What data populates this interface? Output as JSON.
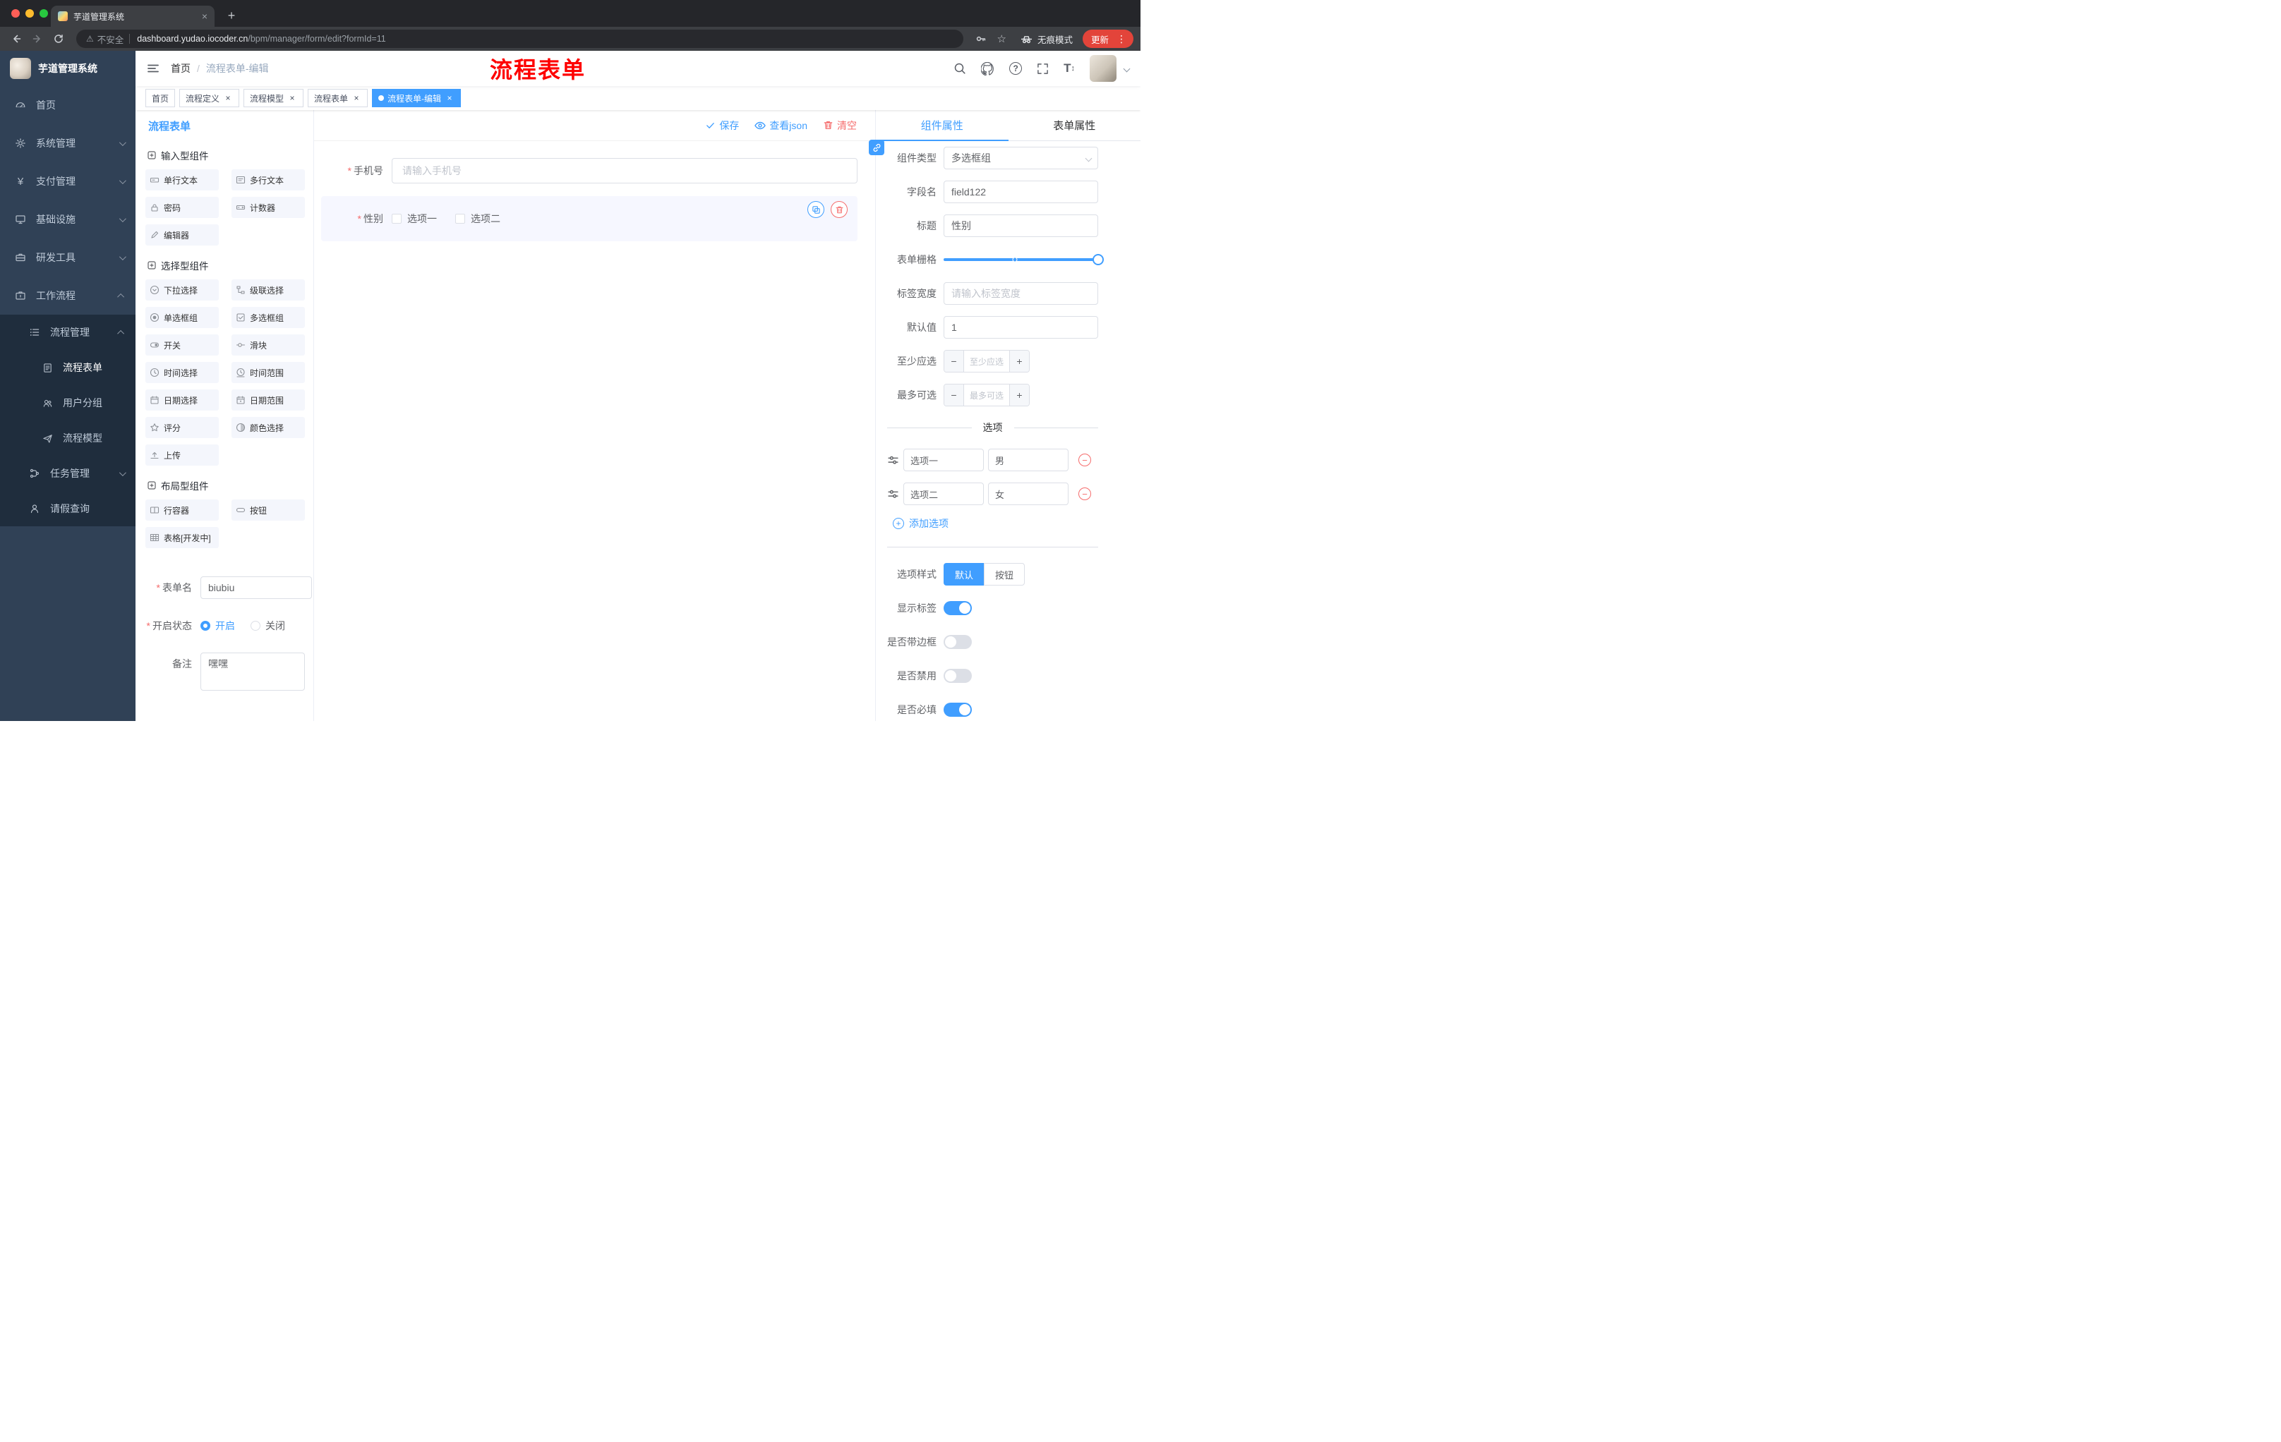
{
  "glyphs": {
    "close": "×",
    "plus": "+",
    "minus": "−",
    "kebab": "⋮",
    "yen": "¥",
    "question": "?",
    "font_t": "T",
    "updown": "↕",
    "warning": "⚠",
    "star": "☆",
    "slash": "/",
    "required": "*"
  },
  "browser": {
    "tab_title": "芋道管理系统",
    "security_label": "不安全",
    "url_host": "dashboard.yudao.iocoder.cn",
    "url_path": "/bpm/manager/form/edit?formId=11",
    "incognito_label": "无痕模式",
    "update_label": "更新"
  },
  "sidebar": {
    "logo_title": "芋道管理系统",
    "menu": [
      {
        "label": "首页",
        "icon": "dashboard-icon"
      },
      {
        "label": "系统管理",
        "icon": "gear-icon"
      },
      {
        "label": "支付管理",
        "icon": "yen-icon"
      },
      {
        "label": "基础设施",
        "icon": "monitor-icon"
      },
      {
        "label": "研发工具",
        "icon": "toolbox-icon"
      },
      {
        "label": "工作流程",
        "icon": "briefcase-icon"
      }
    ],
    "process_group": {
      "label": "流程管理",
      "children": [
        {
          "label": "流程表单",
          "icon": "document-icon"
        },
        {
          "label": "用户分组",
          "icon": "users-icon"
        },
        {
          "label": "流程模型",
          "icon": "send-icon"
        }
      ]
    },
    "task_group": {
      "label": "任务管理"
    },
    "leave_item": {
      "label": "请假查询"
    }
  },
  "header": {
    "breadcrumb_home": "首页",
    "breadcrumb_current": "流程表单-编辑",
    "annotation": "流程表单"
  },
  "tags": [
    {
      "label": "首页"
    },
    {
      "label": "流程定义"
    },
    {
      "label": "流程模型"
    },
    {
      "label": "流程表单"
    },
    {
      "label": "流程表单-编辑"
    }
  ],
  "designer": {
    "title": "流程表单",
    "toolbar": {
      "save": "保存",
      "view_json": "查看json",
      "clear": "清空"
    },
    "palette": [
      {
        "title": "输入型组件",
        "items": [
          "单行文本",
          "多行文本",
          "密码",
          "计数器",
          "编辑器"
        ]
      },
      {
        "title": "选择型组件",
        "items": [
          "下拉选择",
          "级联选择",
          "单选框组",
          "多选框组",
          "开关",
          "滑块",
          "时间选择",
          "时间范围",
          "日期选择",
          "日期范围",
          "评分",
          "颜色选择",
          "上传"
        ]
      },
      {
        "title": "布局型组件",
        "items": [
          "行容器",
          "按钮",
          "表格[开发中]"
        ]
      }
    ],
    "meta": {
      "name_label": "表单名",
      "name_value": "biubiu",
      "status_label": "开启状态",
      "status_on": "开启",
      "status_off": "关闭",
      "remark_label": "备注",
      "remark_value": "嘿嘿"
    }
  },
  "canvas": {
    "phone_label": "手机号",
    "phone_placeholder": "请输入手机号",
    "gender_label": "性别",
    "option1": "选项一",
    "option2": "选项二"
  },
  "props": {
    "tab_component": "组件属性",
    "tab_form": "表单属性",
    "type_label": "组件类型",
    "type_value": "多选框组",
    "field_label": "字段名",
    "field_value": "field122",
    "title_label": "标题",
    "title_value": "性别",
    "grid_label": "表单栅格",
    "labelwidth_label": "标签宽度",
    "labelwidth_placeholder": "请输入标签宽度",
    "default_label": "默认值",
    "default_value": "1",
    "min_label": "至少应选",
    "min_placeholder": "至少应选",
    "max_label": "最多可选",
    "max_placeholder": "最多可选",
    "options_divider": "选项",
    "options": [
      {
        "label": "选项一",
        "value": "男"
      },
      {
        "label": "选项二",
        "value": "女"
      }
    ],
    "add_option": "添加选项",
    "style_label": "选项样式",
    "style_default": "默认",
    "style_button": "按钮",
    "show_label": "显示标签",
    "border_label": "是否带边框",
    "disabled_label": "是否禁用",
    "required_label": "是否必填",
    "accent_color": "#409eff",
    "danger_color": "#f56c6c"
  }
}
